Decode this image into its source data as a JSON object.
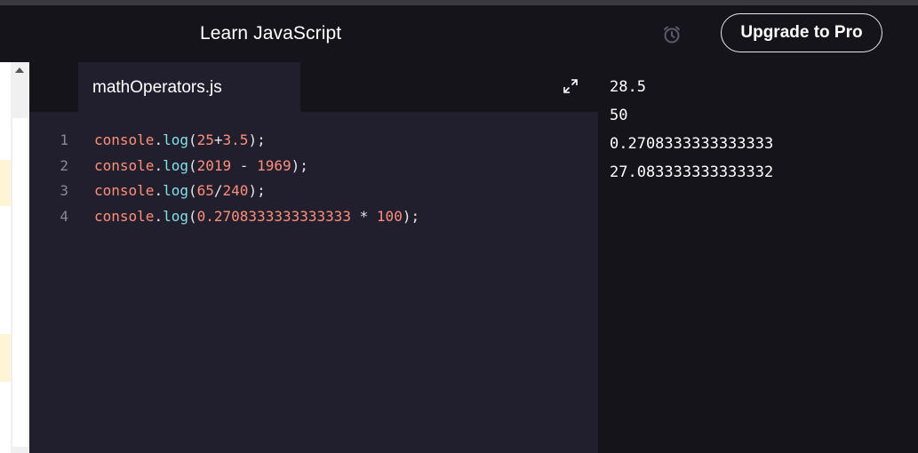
{
  "header": {
    "course_title": "Learn JavaScript",
    "upgrade_label": "Upgrade to Pro",
    "alarm_icon": "alarm-clock-icon"
  },
  "editor": {
    "tab_label": "mathOperators.js",
    "expand_icon": "expand-icon",
    "lines": [
      {
        "num": "1",
        "tokens": [
          [
            "console",
            "obj"
          ],
          [
            ".",
            "dot"
          ],
          [
            "log",
            "fn"
          ],
          [
            "(",
            "pun"
          ],
          [
            "25",
            "num"
          ],
          [
            "+",
            "op"
          ],
          [
            "3.5",
            "num"
          ],
          [
            ");",
            "pun"
          ]
        ]
      },
      {
        "num": "2",
        "tokens": [
          [
            "console",
            "obj"
          ],
          [
            ".",
            "dot"
          ],
          [
            "log",
            "fn"
          ],
          [
            "(",
            "pun"
          ],
          [
            "2019",
            "num"
          ],
          [
            " - ",
            "op"
          ],
          [
            "1969",
            "num"
          ],
          [
            ");",
            "pun"
          ]
        ]
      },
      {
        "num": "3",
        "tokens": [
          [
            "console",
            "obj"
          ],
          [
            ".",
            "dot"
          ],
          [
            "log",
            "fn"
          ],
          [
            "(",
            "pun"
          ],
          [
            "65",
            "num"
          ],
          [
            "/",
            "op"
          ],
          [
            "240",
            "num"
          ],
          [
            ");",
            "pun"
          ]
        ]
      },
      {
        "num": "4",
        "tokens": [
          [
            "console",
            "obj"
          ],
          [
            ".",
            "dot"
          ],
          [
            "log",
            "fn"
          ],
          [
            "(",
            "pun"
          ],
          [
            "0.2708333333333333",
            "num"
          ],
          [
            " * ",
            "op"
          ],
          [
            "100",
            "num"
          ],
          [
            ");",
            "pun"
          ]
        ]
      }
    ]
  },
  "output": {
    "lines": [
      "28.5",
      "50",
      "0.2708333333333333",
      "27.083333333333332"
    ]
  },
  "colors": {
    "background": "#1b1a22",
    "editor_bg": "#211f2d",
    "panel_bg": "#15141a",
    "keyword": "#ff8f7a",
    "function": "#82e0e8"
  }
}
